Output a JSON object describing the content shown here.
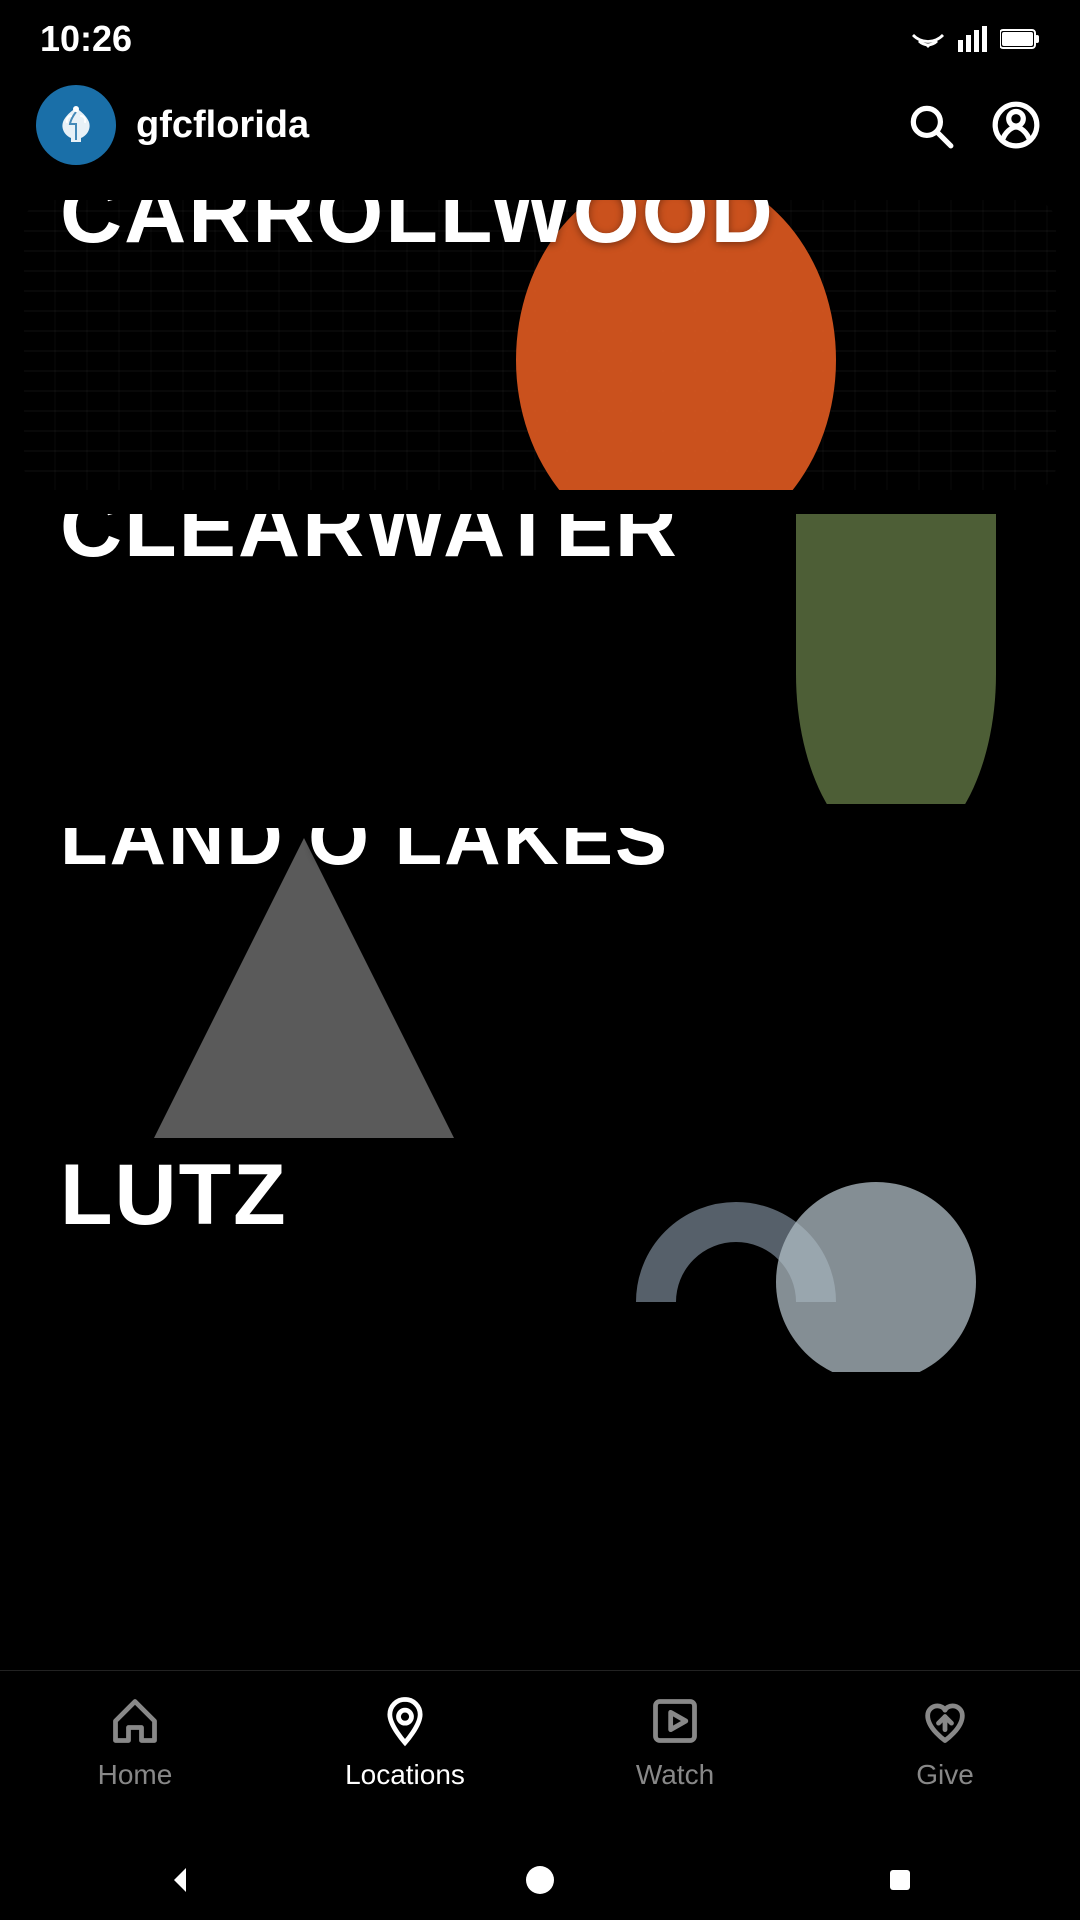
{
  "statusBar": {
    "time": "10:26"
  },
  "header": {
    "brandName": "gfcflorida",
    "searchLabel": "search",
    "profileLabel": "profile"
  },
  "locations": [
    {
      "id": "carrollwood",
      "label": "CARROLLWOOD",
      "decorationColor": "#e05a20"
    },
    {
      "id": "clearwater",
      "label": "CLEARWATER",
      "decorationColor": "#5a6e40"
    },
    {
      "id": "landolakes",
      "label": "LAND O LAKES",
      "decorationColor": "#808080"
    },
    {
      "id": "lutz",
      "label": "LUTZ",
      "decorationColor": "#b0bec5"
    }
  ],
  "bottomNav": {
    "items": [
      {
        "id": "home",
        "label": "Home",
        "active": false
      },
      {
        "id": "locations",
        "label": "Locations",
        "active": true
      },
      {
        "id": "watch",
        "label": "Watch",
        "active": false
      },
      {
        "id": "give",
        "label": "Give",
        "active": false
      }
    ]
  }
}
